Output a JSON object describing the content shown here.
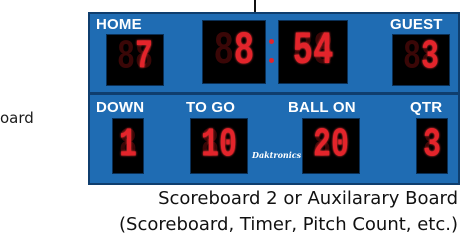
{
  "left_text": "oard",
  "scoreboard": {
    "labels": {
      "home": "HOME",
      "guest": "GUEST",
      "down": "DOWN",
      "to_go": "TO GO",
      "ball_on": "BALL ON",
      "qtr": "QTR"
    },
    "values": {
      "home_score": "7",
      "clock_minutes": "8",
      "clock_seconds": "54",
      "guest_score": "3",
      "down": "1",
      "to_go": "10",
      "ball_on": "20",
      "qtr": "3"
    },
    "brand": "Daktronics"
  },
  "caption": {
    "line1": "Scoreboard 2 or Auxilarary Board",
    "line2": "(Scoreboard, Timer, Pitch Count, etc.)"
  },
  "colors": {
    "board": "#1f6cb3",
    "digit_lit": "#e3242b",
    "digit_unlit": "#3a0707"
  }
}
